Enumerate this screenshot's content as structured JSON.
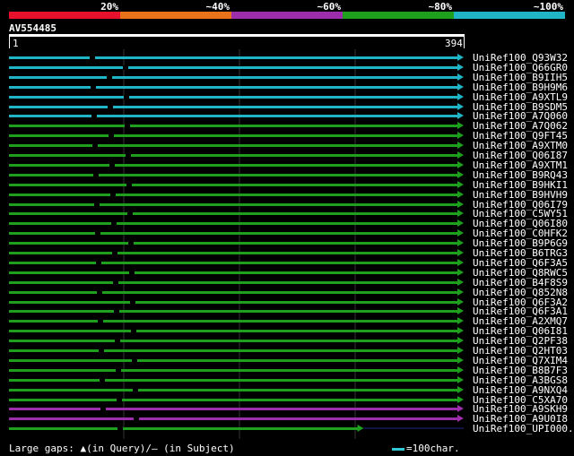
{
  "legend": [
    {
      "label": "20%",
      "color": "#e8112d"
    },
    {
      "label": "~40%",
      "color": "#e8731a"
    },
    {
      "label": "~60%",
      "color": "#9c2eab"
    },
    {
      "label": "~80%",
      "color": "#1ea01e"
    },
    {
      "label": "~100%",
      "color": "#1fb5c6"
    }
  ],
  "query": {
    "name": "AV554485",
    "start": "1",
    "end": "394"
  },
  "hits": [
    {
      "name": "UniRef100_Q93W32",
      "color": "#1fb5c6"
    },
    {
      "name": "UniRef100_Q66GR0",
      "color": "#1fb5c6"
    },
    {
      "name": "UniRef100_B9IIH5",
      "color": "#1fb5c6"
    },
    {
      "name": "UniRef100_B9H9M6",
      "color": "#1fb5c6"
    },
    {
      "name": "UniRef100_A9XTL9",
      "color": "#1fb5c6"
    },
    {
      "name": "UniRef100_B9SDM5",
      "color": "#1fb5c6"
    },
    {
      "name": "UniRef100_A7Q060",
      "color": "#1fb5c6"
    },
    {
      "name": "UniRef100_A7Q062",
      "color": "#1ea01e"
    },
    {
      "name": "UniRef100_Q9FT45",
      "color": "#1ea01e"
    },
    {
      "name": "UniRef100_A9XTM0",
      "color": "#1ea01e"
    },
    {
      "name": "UniRef100_Q06I87",
      "color": "#1ea01e"
    },
    {
      "name": "UniRef100_A9XTM1",
      "color": "#1ea01e"
    },
    {
      "name": "UniRef100_B9RQ43",
      "color": "#1ea01e"
    },
    {
      "name": "UniRef100_B9HKI1",
      "color": "#1ea01e"
    },
    {
      "name": "UniRef100_B9HVH9",
      "color": "#1ea01e"
    },
    {
      "name": "UniRef100_Q06I79",
      "color": "#1ea01e"
    },
    {
      "name": "UniRef100_C5WY51",
      "color": "#1ea01e"
    },
    {
      "name": "UniRef100_Q06I80",
      "color": "#1ea01e"
    },
    {
      "name": "UniRef100_C0HFK2",
      "color": "#1ea01e"
    },
    {
      "name": "UniRef100_B9P6G9",
      "color": "#1ea01e"
    },
    {
      "name": "UniRef100_B6TRG3",
      "color": "#1ea01e"
    },
    {
      "name": "UniRef100_Q6F3A5",
      "color": "#1ea01e"
    },
    {
      "name": "UniRef100_Q8RWC5",
      "color": "#1ea01e"
    },
    {
      "name": "UniRef100_B4F8S9",
      "color": "#1ea01e"
    },
    {
      "name": "UniRef100_Q852N8",
      "color": "#1ea01e"
    },
    {
      "name": "UniRef100_Q6F3A2",
      "color": "#1ea01e"
    },
    {
      "name": "UniRef100_Q6F3A1",
      "color": "#1ea01e"
    },
    {
      "name": "UniRef100_A2XMQ7",
      "color": "#1ea01e"
    },
    {
      "name": "UniRef100_Q06I81",
      "color": "#1ea01e"
    },
    {
      "name": "UniRef100_Q2PF38",
      "color": "#1ea01e"
    },
    {
      "name": "UniRef100_Q2HT03",
      "color": "#1ea01e"
    },
    {
      "name": "UniRef100_Q7XIM4",
      "color": "#1ea01e"
    },
    {
      "name": "UniRef100_B8B7F3",
      "color": "#1ea01e"
    },
    {
      "name": "UniRef100_A3BGS8",
      "color": "#1ea01e"
    },
    {
      "name": "UniRef100_A9NXQ4",
      "color": "#1ea01e"
    },
    {
      "name": "UniRef100_C5XA70",
      "color": "#1ea01e"
    },
    {
      "name": "UniRef100_A9SKH9",
      "color": "#9c2eab"
    },
    {
      "name": "UniRef100_A9U0I8",
      "color": "#9c2eab"
    },
    {
      "name": "UniRef100_UPI000..",
      "color": "#1ea01e",
      "partial": 0.78
    }
  ],
  "footer": {
    "left": "Large gaps: ▲(in Query)/– (in Subject)",
    "right": "=100char."
  }
}
